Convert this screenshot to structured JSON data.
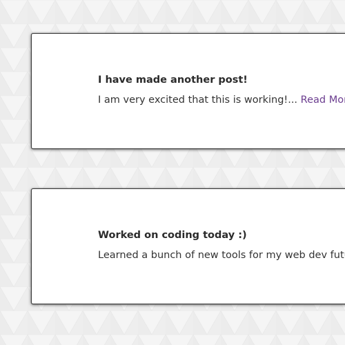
{
  "colors": {
    "background": "#f1f1f1",
    "card_background": "#ffffff",
    "card_border": "#3a3a3a",
    "title_text": "#2b2b2b",
    "body_text": "#333333",
    "link": "#6b3d8f"
  },
  "posts": [
    {
      "title": "I have made another post!",
      "excerpt": "I am very excited that this is working!...",
      "read_more": "Read More"
    },
    {
      "title": "Worked on coding today :)",
      "excerpt": "Learned a bunch of new tools for my web dev futur",
      "read_more": ""
    }
  ]
}
